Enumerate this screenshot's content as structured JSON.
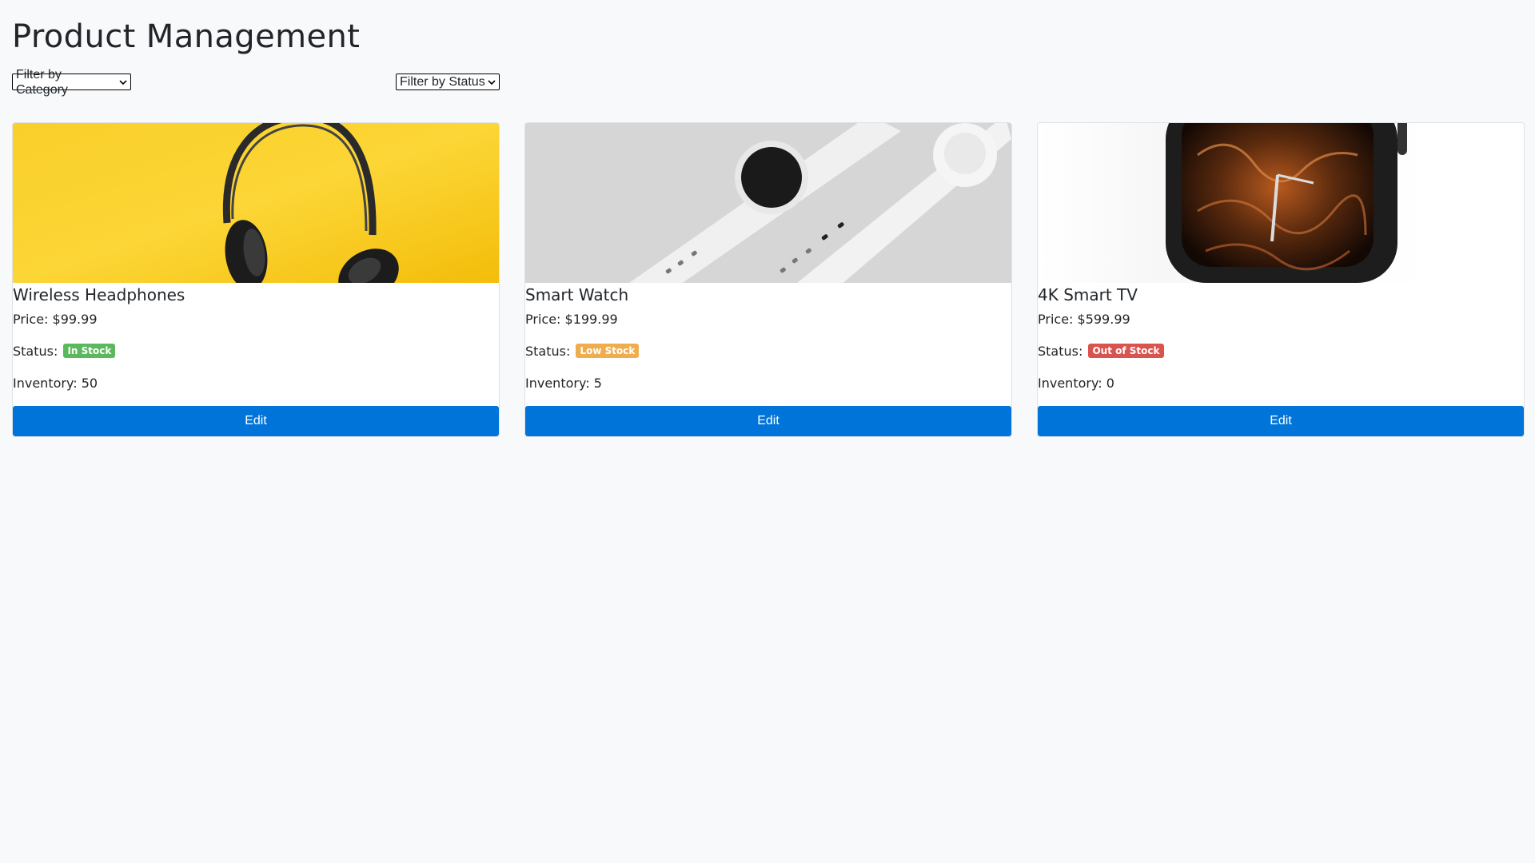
{
  "page": {
    "title": "Product Management"
  },
  "filters": {
    "category": {
      "selected": "Filter by Category"
    },
    "status": {
      "selected": "Filter by Status"
    }
  },
  "labels": {
    "price_prefix": "Price: ",
    "status_prefix": "Status: ",
    "inventory_prefix": "Inventory: ",
    "edit": "Edit"
  },
  "products": [
    {
      "name": "Wireless Headphones",
      "price": "$99.99",
      "status": "In Stock",
      "status_color": "#5cb85c",
      "inventory": "50",
      "image": "headphones"
    },
    {
      "name": "Smart Watch",
      "price": "$199.99",
      "status": "Low Stock",
      "status_color": "#f0ad4e",
      "inventory": "5",
      "image": "smart-watch"
    },
    {
      "name": "4K Smart TV",
      "price": "$599.99",
      "status": "Out of Stock",
      "status_color": "#d9534f",
      "inventory": "0",
      "image": "smartwatch-closeup"
    }
  ],
  "colors": {
    "background": "#f8f9fa",
    "primary_button": "#0074d9"
  }
}
